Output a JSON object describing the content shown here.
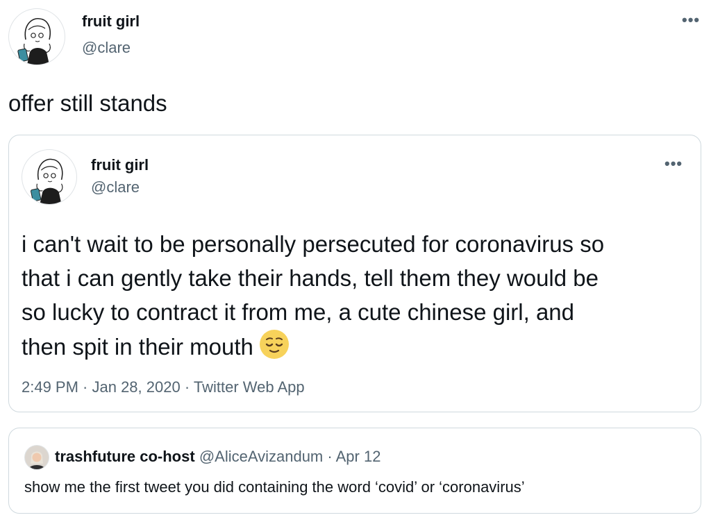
{
  "main_tweet": {
    "display_name": "fruit girl",
    "handle": "@clare",
    "more_icon": "more-horizontal-icon",
    "text": "offer still stands"
  },
  "quoted_tweet": {
    "display_name": "fruit girl",
    "handle": "@clare",
    "more_icon": "more-horizontal-icon",
    "lines": [
      "i can't wait to be personally persecuted for coronavirus so",
      "that i can gently take their hands, tell them they would be",
      "so lucky to contract it from me, a cute chinese girl, and",
      "then spit in their mouth"
    ],
    "emoji": "relieved-face-emoji",
    "timestamp": "2:49 PM · Jan 28, 2020 · Twitter Web App"
  },
  "reply": {
    "display_name": "trashfuture co-host",
    "handle": "@AliceAvizandum",
    "separator": "·",
    "date": "Apr 12",
    "text": "show me the first tweet you did containing the word ‘covid’ or ‘coronavirus’"
  }
}
